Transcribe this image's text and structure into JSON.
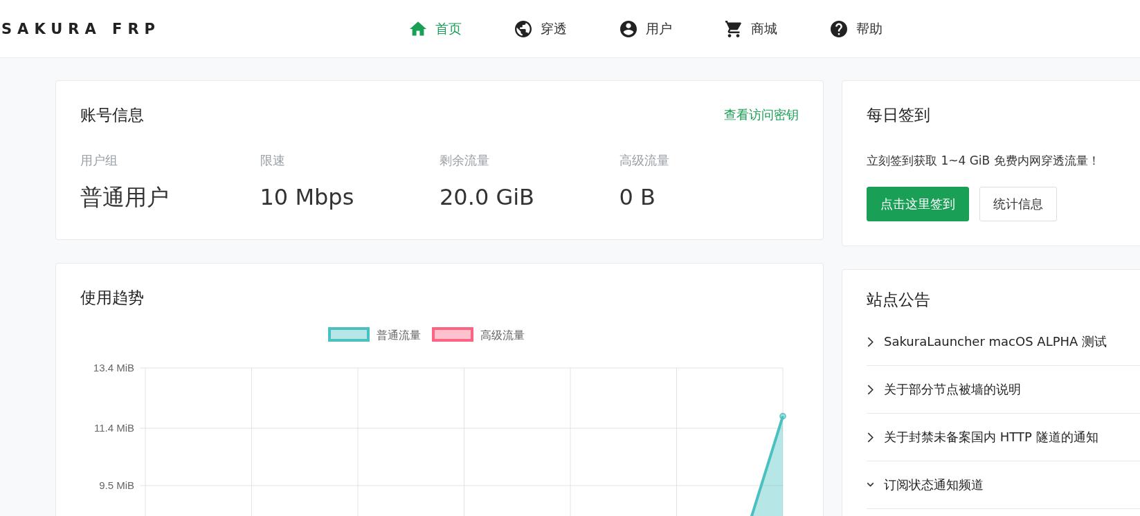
{
  "header": {
    "logo": "SAKURA FRP",
    "nav": [
      {
        "label": "首页",
        "kind": "home",
        "selected": true
      },
      {
        "label": "穿透",
        "kind": "globe",
        "selected": false
      },
      {
        "label": "用户",
        "kind": "account",
        "selected": false
      },
      {
        "label": "商城",
        "kind": "cart",
        "selected": false
      },
      {
        "label": "帮助",
        "kind": "help",
        "selected": false
      }
    ]
  },
  "account": {
    "title": "账号信息",
    "link": "查看访问密钥",
    "stats": [
      {
        "label": "用户组",
        "value": "普通用户"
      },
      {
        "label": "限速",
        "value": "10 Mbps"
      },
      {
        "label": "剩余流量",
        "value": "20.0 GiB"
      },
      {
        "label": "高级流量",
        "value": "0 B"
      }
    ]
  },
  "usage": {
    "title": "使用趋势",
    "chart_data": {
      "type": "area",
      "grid": true,
      "ylim": [
        0,
        13.4
      ],
      "yticks": [
        {
          "value": 13.4,
          "label": "13.4 MiB"
        },
        {
          "value": 11.4,
          "label": "11.4 MiB"
        },
        {
          "value": 9.5,
          "label": "9.5 MiB"
        }
      ],
      "series": [
        {
          "name": "普通流量",
          "color": "#4bc0c0",
          "values": [
            0,
            0,
            0,
            0,
            0,
            0.5,
            11.8
          ]
        },
        {
          "name": "高级流量",
          "color": "#ff6384"
        }
      ]
    }
  },
  "checkin": {
    "title": "每日签到",
    "text": "立刻签到获取 1~4 GiB 免费内网穿透流量！",
    "buttons": [
      {
        "label": "点击这里签到",
        "kind": "primary"
      },
      {
        "label": "统计信息",
        "kind": "secondary"
      }
    ]
  },
  "notices": {
    "title": "站点公告",
    "items": [
      {
        "text": "SakuraLauncher macOS ALPHA 测试",
        "expanded": false
      },
      {
        "text": "关于部分节点被墙的说明",
        "expanded": false
      },
      {
        "text": "关于封禁未备案国内 HTTP 隧道的通知",
        "expanded": false
      },
      {
        "text": "订阅状态通知频道",
        "expanded": true
      }
    ]
  }
}
